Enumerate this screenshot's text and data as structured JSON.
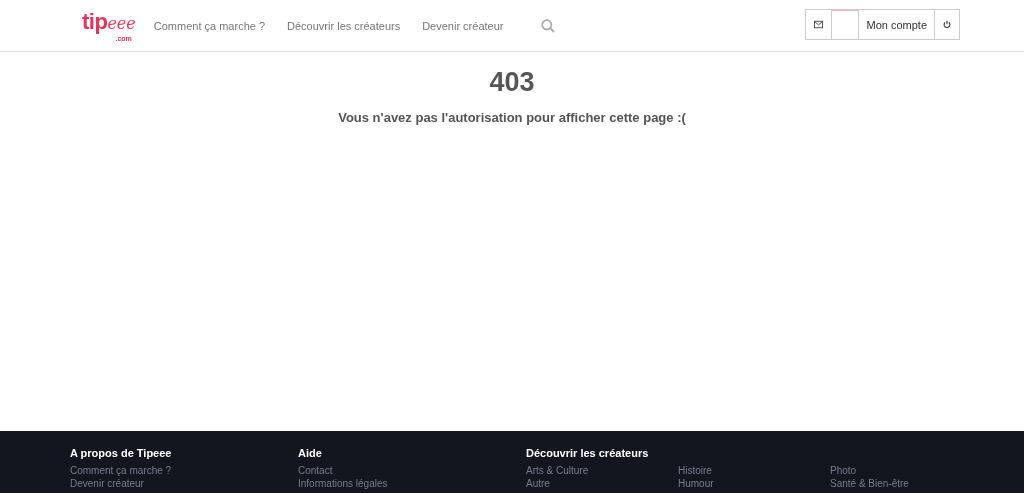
{
  "header": {
    "logo": {
      "main": "tip",
      "script": "eee",
      "suffix": ".com"
    },
    "nav": [
      "Comment ça marche ?",
      "Découvrir les créateurs",
      "Devenir créateur"
    ],
    "account": {
      "label": "Mon compte"
    }
  },
  "error": {
    "code": "403",
    "message": "Vous n'avez pas l'autorisation pour afficher cette page :("
  },
  "footer": {
    "columns": [
      {
        "title": "A propos de Tipeee",
        "links": [
          "Comment ça marche ?",
          "Devenir créateur"
        ]
      },
      {
        "title": "Aide",
        "links": [
          "Contact",
          "Informations légales"
        ]
      },
      {
        "title": "Découvrir les créateurs",
        "links": [
          "Arts & Culture",
          "Autre"
        ]
      },
      {
        "links": [
          "Histoire",
          "Humour"
        ]
      },
      {
        "links": [
          "Photo",
          "Santé & Bien-être"
        ]
      }
    ]
  }
}
